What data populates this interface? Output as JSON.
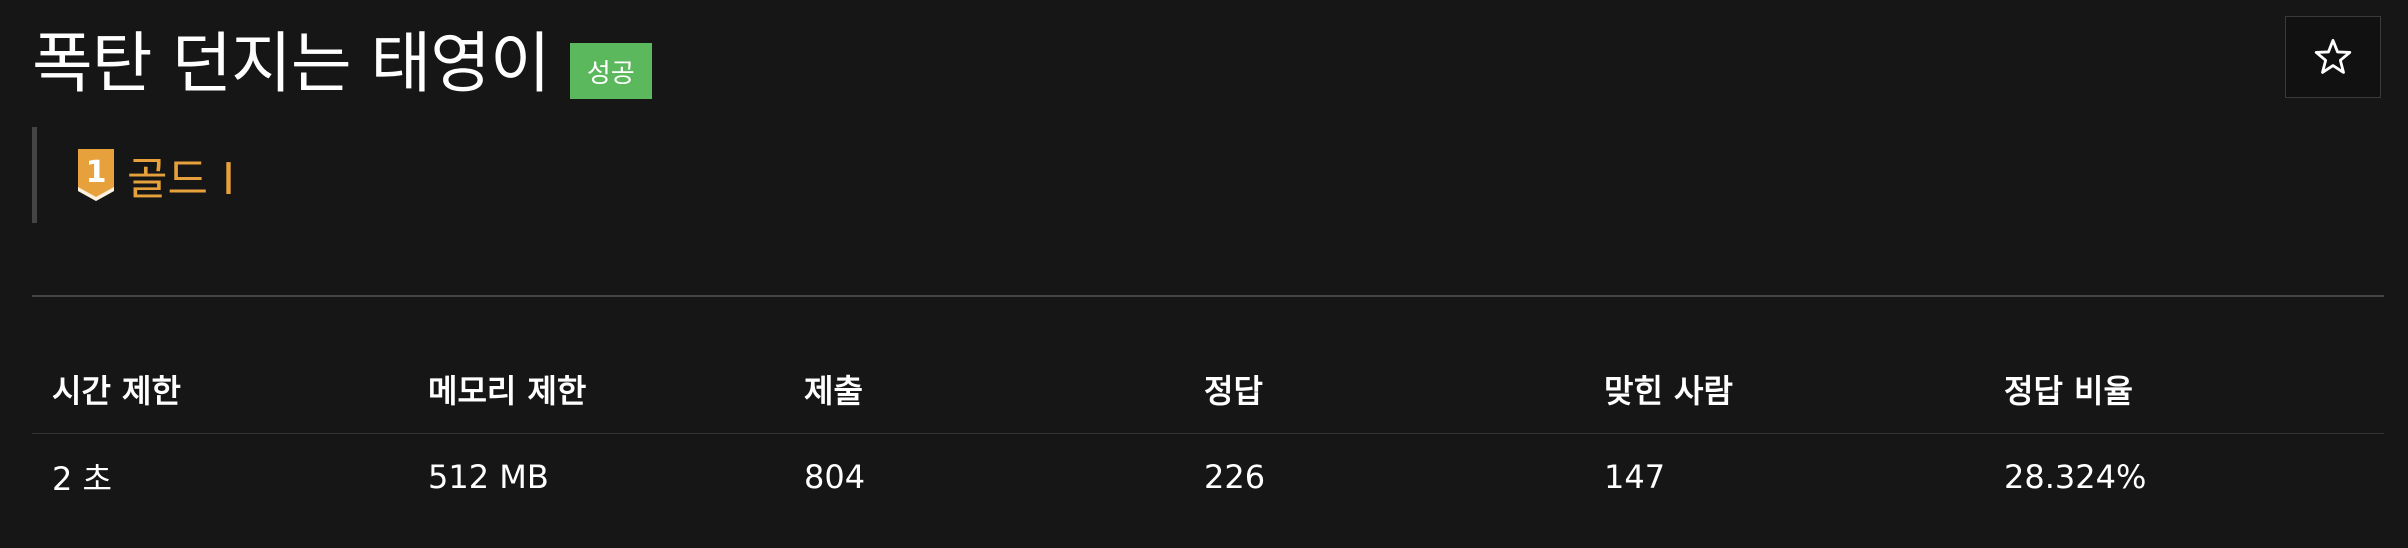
{
  "problem": {
    "title": "폭탄 던지는 태영이",
    "status_badge": "성공",
    "star_icon": "☆",
    "tier": {
      "number": "1",
      "label": "골드 I",
      "color": "#e6a03c"
    }
  },
  "info_table": {
    "headers": [
      "시간 제한",
      "메모리 제한",
      "제출",
      "정답",
      "맞힌 사람",
      "정답 비율"
    ],
    "values": [
      "2 초",
      "512 MB",
      "804",
      "226",
      "147",
      "28.324%"
    ]
  },
  "colors": {
    "background": "#161616",
    "success_badge": "#5cb85c",
    "tier_gold": "#e6a03c"
  }
}
